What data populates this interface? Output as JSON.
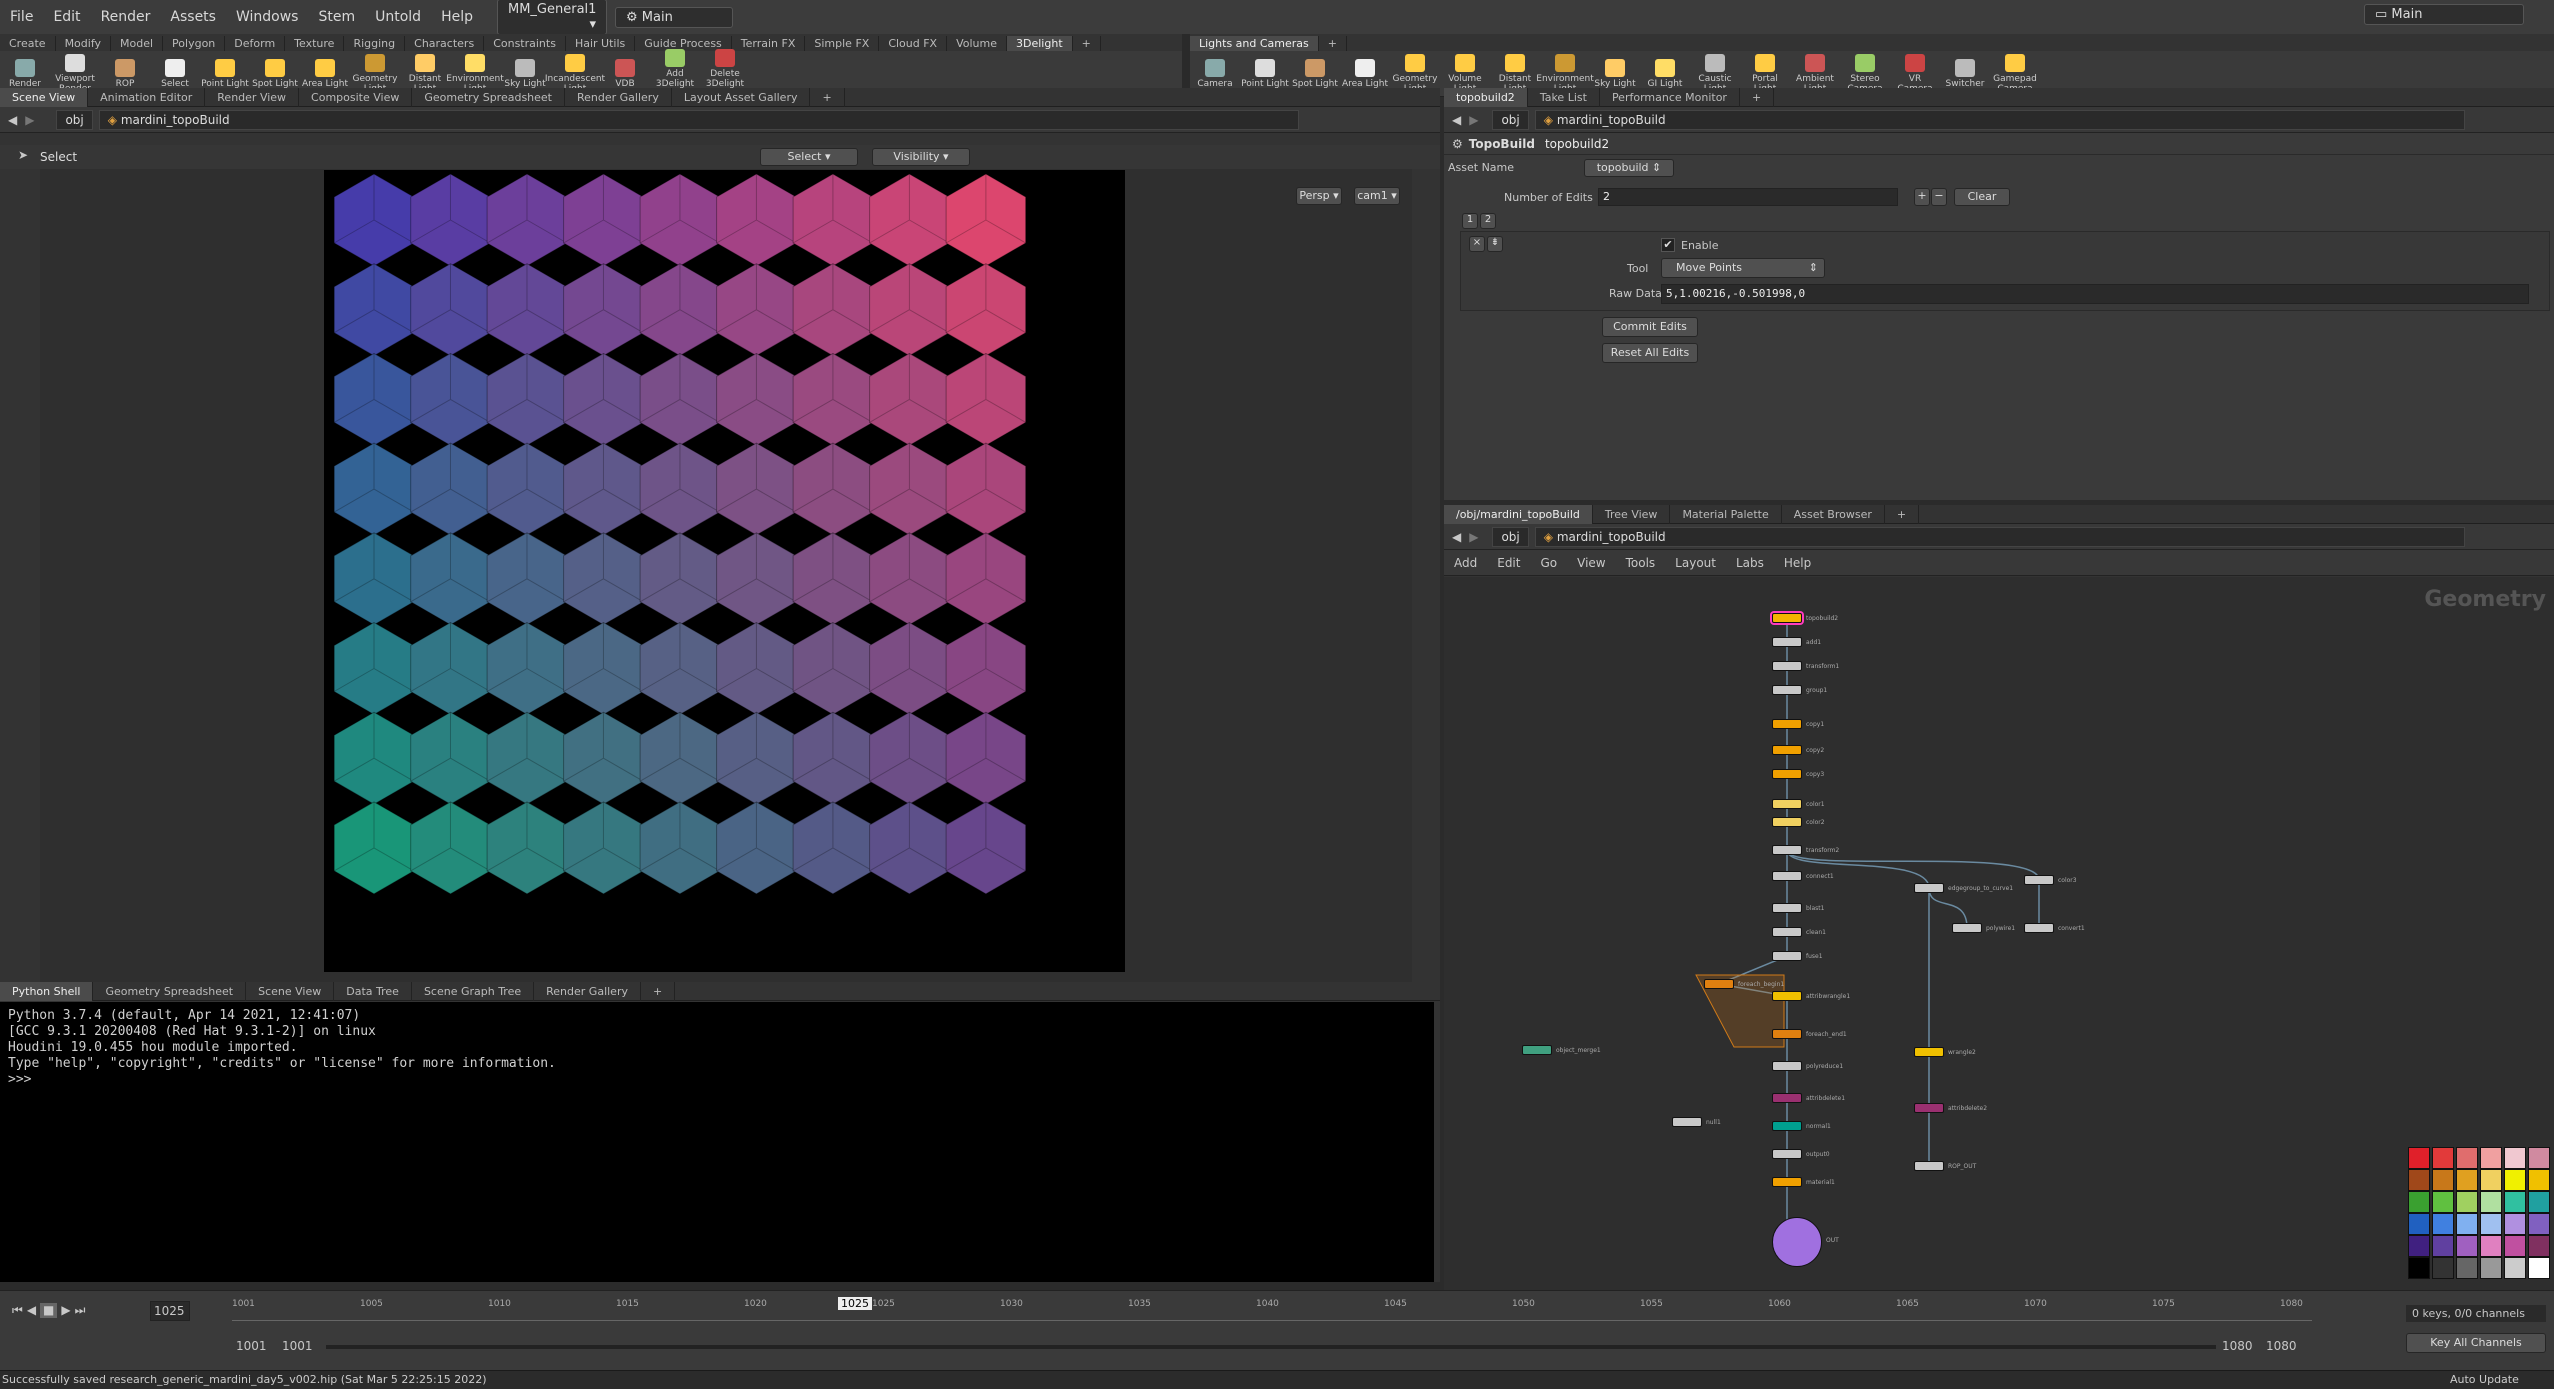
{
  "menubar": {
    "items": [
      "File",
      "Edit",
      "Render",
      "Assets",
      "Windows",
      "Stem",
      "Untold",
      "Help"
    ],
    "desktop": "MM_General1",
    "context": "Main",
    "right_desktop": "Main"
  },
  "shelf_left": {
    "tabs": [
      "Create",
      "Modify",
      "Model",
      "Polygon",
      "Deform",
      "Texture",
      "Rigging",
      "Characters",
      "Constraints",
      "Hair Utils",
      "Guide Process",
      "Terrain FX",
      "Simple FX",
      "Cloud FX",
      "Volume",
      "3Delight"
    ],
    "active_tab": "3Delight",
    "tools": [
      "Render",
      "Viewport Render",
      "ROP",
      "Select",
      "Point Light",
      "Spot Light",
      "Area Light",
      "Geometry Light",
      "Distant Light",
      "Environment Light",
      "Sky Light",
      "Incandescent Light",
      "VDB",
      "Add 3Delight Properties",
      "Delete 3Delight Pro."
    ]
  },
  "shelf_right": {
    "tabs": [
      "Lights and Cameras"
    ],
    "tools": [
      "Camera",
      "Point Light",
      "Spot Light",
      "Area Light",
      "Geometry Light",
      "Volume Light",
      "Distant Light",
      "Environment Light",
      "Sky Light",
      "GI Light",
      "Caustic Light",
      "Portal Light",
      "Ambient Light",
      "Stereo Camera",
      "VR Camera",
      "Switcher",
      "Gamepad Camera"
    ]
  },
  "viewer": {
    "tabs": [
      "Scene View",
      "Animation Editor",
      "Render View",
      "Composite View",
      "Geometry Spreadsheet",
      "Render Gallery",
      "Layout Asset Gallery"
    ],
    "path_root": "obj",
    "path_node": "mardini_topoBuild",
    "mode_label": "Select",
    "select_dropdown": "Select",
    "visibility_dropdown": "Visibility",
    "persp": "Persp",
    "camera": "cam1"
  },
  "params": {
    "tabs": [
      "topobuild2",
      "Take List",
      "Performance Monitor"
    ],
    "path_root": "obj",
    "path_node": "mardini_topoBuild",
    "node_type": "TopoBuild",
    "node_name": "topobuild2",
    "asset_name_label": "Asset Name",
    "asset_name_value": "topobuild",
    "num_edits_label": "Number of Edits",
    "num_edits_value": "2",
    "clear_label": "Clear",
    "multi_tabs": [
      "1",
      "2"
    ],
    "enable_label": "Enable",
    "tool_label": "Tool",
    "tool_value": "Move Points",
    "raw_data_label": "Raw Data",
    "raw_data_value": "5,1.00216,-0.501998,0",
    "commit_label": "Commit Edits",
    "reset_label": "Reset All Edits"
  },
  "network": {
    "tabs": [
      "/obj/mardini_topoBuild",
      "Tree View",
      "Material Palette",
      "Asset Browser"
    ],
    "path_root": "obj",
    "path_node": "mardini_topoBuild",
    "menu": [
      "Add",
      "Edit",
      "Go",
      "View",
      "Tools",
      "Layout",
      "Labs",
      "Help"
    ],
    "context_label": "Geometry"
  },
  "bottom_panel": {
    "tabs": [
      "Python Shell",
      "Geometry Spreadsheet",
      "Scene View",
      "Data Tree",
      "Scene Graph Tree",
      "Render Gallery"
    ],
    "console_lines": [
      "Python 3.7.4 (default, Apr 14 2021, 12:41:07)",
      "[GCC 9.3.1 20200408 (Red Hat 9.3.1-2)] on linux",
      "Houdini 19.0.455 hou module imported.",
      "Type \"help\", \"copyright\", \"credits\" or \"license\" for more information.",
      ">>>"
    ]
  },
  "timeline": {
    "current_frame": "1025",
    "marker_frame": "1025",
    "range_start": "1001",
    "range_start2": "1001",
    "range_end": "1080",
    "range_end2": "1080",
    "keys_label": "0 keys, 0/0 channels",
    "key_all_label": "Key All Channels",
    "auto_update": "Auto Update",
    "tick_labels": [
      "1001",
      "1005",
      "1010",
      "1015",
      "1020",
      "1025",
      "1030",
      "1035",
      "1040",
      "1045",
      "1050",
      "1055",
      "1060",
      "1065",
      "1070",
      "1075",
      "1080"
    ]
  },
  "status": {
    "message": "Successfully saved research_generic_mardini_day5_v002.hip (Sat Mar  5 22:25:15 2022)"
  },
  "palette": {
    "colors": [
      "#e0202a",
      "#e23a3a",
      "#e06d6d",
      "#f0a0a0",
      "#f0c8d0",
      "#d08aa0",
      "#a0481a",
      "#c8781a",
      "#e0a020",
      "#f0d060",
      "#f0f000",
      "#f0c000",
      "#3aa030",
      "#60c040",
      "#a0d060",
      "#b0e0a0",
      "#30c0a0",
      "#20a0a0",
      "#2060c0",
      "#4080e0",
      "#80b0f0",
      "#a0c0f0",
      "#b090e0",
      "#8060c0",
      "#402080",
      "#6040a0",
      "#a060c0",
      "#e080c0",
      "#c050a0",
      "#803060",
      "#000000",
      "#333333",
      "#666666",
      "#999999",
      "#cccccc",
      "#ffffff"
    ]
  },
  "nodes": [
    {
      "label": "topobuild2",
      "color": "#f5b400",
      "ring": "#ff3cbe"
    },
    {
      "label": "add1",
      "color": "#c8c8c8"
    },
    {
      "label": "transform1",
      "color": "#c8c8c8"
    },
    {
      "label": "group1",
      "color": "#c8c8c8"
    },
    {
      "label": "copy1",
      "color": "#f0a000"
    },
    {
      "label": "copy2",
      "color": "#f0a000"
    },
    {
      "label": "copy3",
      "color": "#f0a000"
    },
    {
      "label": "color1",
      "color": "#f0d060"
    },
    {
      "label": "color2",
      "color": "#f0d060"
    },
    {
      "label": "transform2",
      "color": "#c8c8c8"
    },
    {
      "label": "connect1",
      "color": "#c8c8c8"
    },
    {
      "label": "blast1",
      "color": "#c8c8c8"
    },
    {
      "label": "clean1",
      "color": "#c8c8c8"
    },
    {
      "label": "fuse1",
      "color": "#c8c8c8"
    },
    {
      "label": "foreach_begin1",
      "color": "#e08010"
    },
    {
      "label": "attribwrangle1",
      "color": "#f0c000"
    },
    {
      "label": "foreach_end1",
      "color": "#e08010"
    },
    {
      "label": "polyreduce1",
      "color": "#c8c8c8"
    },
    {
      "label": "attribdelete1",
      "color": "#9a3070"
    },
    {
      "label": "normal1",
      "color": "#00a090"
    },
    {
      "label": "output0",
      "color": "#c8c8c8"
    },
    {
      "label": "material1",
      "color": "#f0a000"
    },
    {
      "label": "OUT",
      "color": "#a070e0"
    },
    {
      "label": "edgegroup_to_curve1",
      "color": "#c8c8c8"
    },
    {
      "label": "polywire1",
      "color": "#c8c8c8"
    },
    {
      "label": "color3",
      "color": "#c8c8c8"
    },
    {
      "label": "convert1",
      "color": "#c8c8c8"
    },
    {
      "label": "attribdelete2",
      "color": "#9a3070"
    },
    {
      "label": "ROP_OUT",
      "color": "#c8c8c8"
    },
    {
      "label": "object_merge1",
      "color": "#40a080"
    },
    {
      "label": "null1",
      "color": "#c8c8c8"
    },
    {
      "label": "wrangle2",
      "color": "#f0c000"
    }
  ]
}
